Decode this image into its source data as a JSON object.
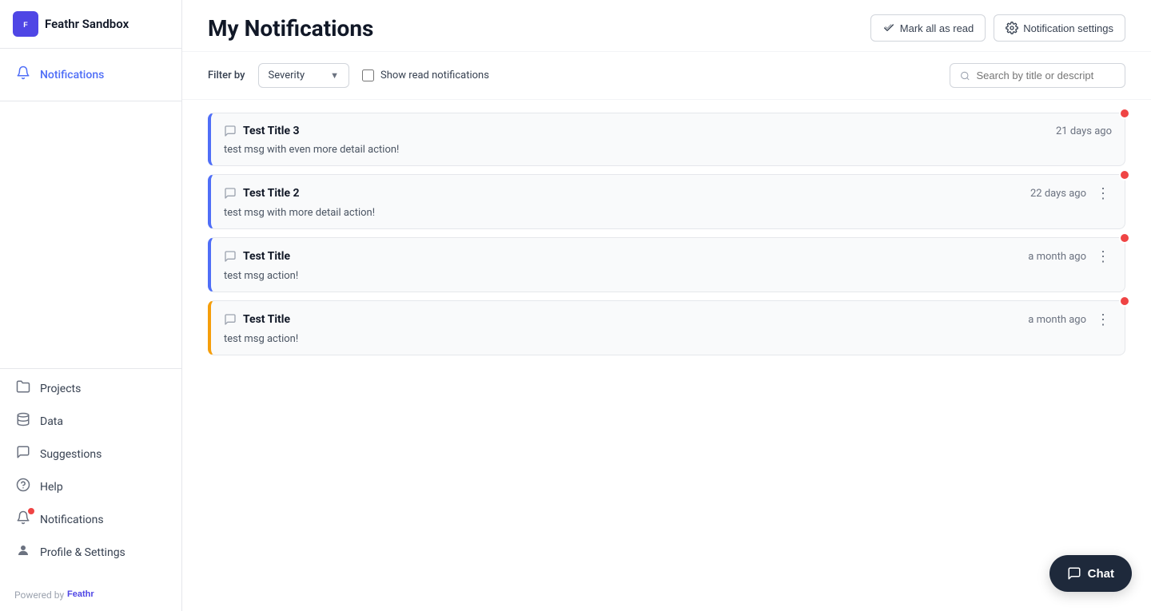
{
  "sidebar": {
    "logo_text": "Feathr Sandbox",
    "logo_abbr": "Feathr",
    "nav_top": [
      {
        "id": "notifications-top",
        "icon": "🔔",
        "label": "Notifications",
        "active": true
      }
    ],
    "nav_bottom": [
      {
        "id": "projects",
        "icon": "📁",
        "label": "Projects",
        "active": false
      },
      {
        "id": "data",
        "icon": "🗄️",
        "label": "Data",
        "active": false
      },
      {
        "id": "suggestions",
        "icon": "💬",
        "label": "Suggestions",
        "active": false
      },
      {
        "id": "help",
        "icon": "❓",
        "label": "Help",
        "active": false
      },
      {
        "id": "notifications",
        "icon": "🔔",
        "label": "Notifications",
        "active": false
      },
      {
        "id": "profile",
        "icon": "👤",
        "label": "Profile & Settings",
        "active": false
      }
    ],
    "footer_text": "Powered by",
    "footer_brand": "Feathr"
  },
  "header": {
    "title": "My Notifications",
    "mark_all_read": "Mark all as read",
    "notification_settings": "Notification settings"
  },
  "filter": {
    "label": "Filter by",
    "severity_placeholder": "Severity",
    "show_read_label": "Show read notifications",
    "search_placeholder": "Search by title or descript"
  },
  "notifications": [
    {
      "id": "notif-1",
      "title": "Test Title 3",
      "time": "21 days ago",
      "body": "test msg with even more detail action!",
      "border": "blue",
      "unread": true,
      "has_menu": false
    },
    {
      "id": "notif-2",
      "title": "Test Title 2",
      "time": "22 days ago",
      "body": "test msg with more detail action!",
      "border": "blue",
      "unread": true,
      "has_menu": true
    },
    {
      "id": "notif-3",
      "title": "Test Title",
      "time": "a month ago",
      "body": "test msg action!",
      "border": "blue",
      "unread": true,
      "has_menu": true
    },
    {
      "id": "notif-4",
      "title": "Test Title",
      "time": "a month ago",
      "body": "test msg action!",
      "border": "yellow",
      "unread": true,
      "has_menu": true
    }
  ],
  "chat": {
    "label": "Chat"
  }
}
